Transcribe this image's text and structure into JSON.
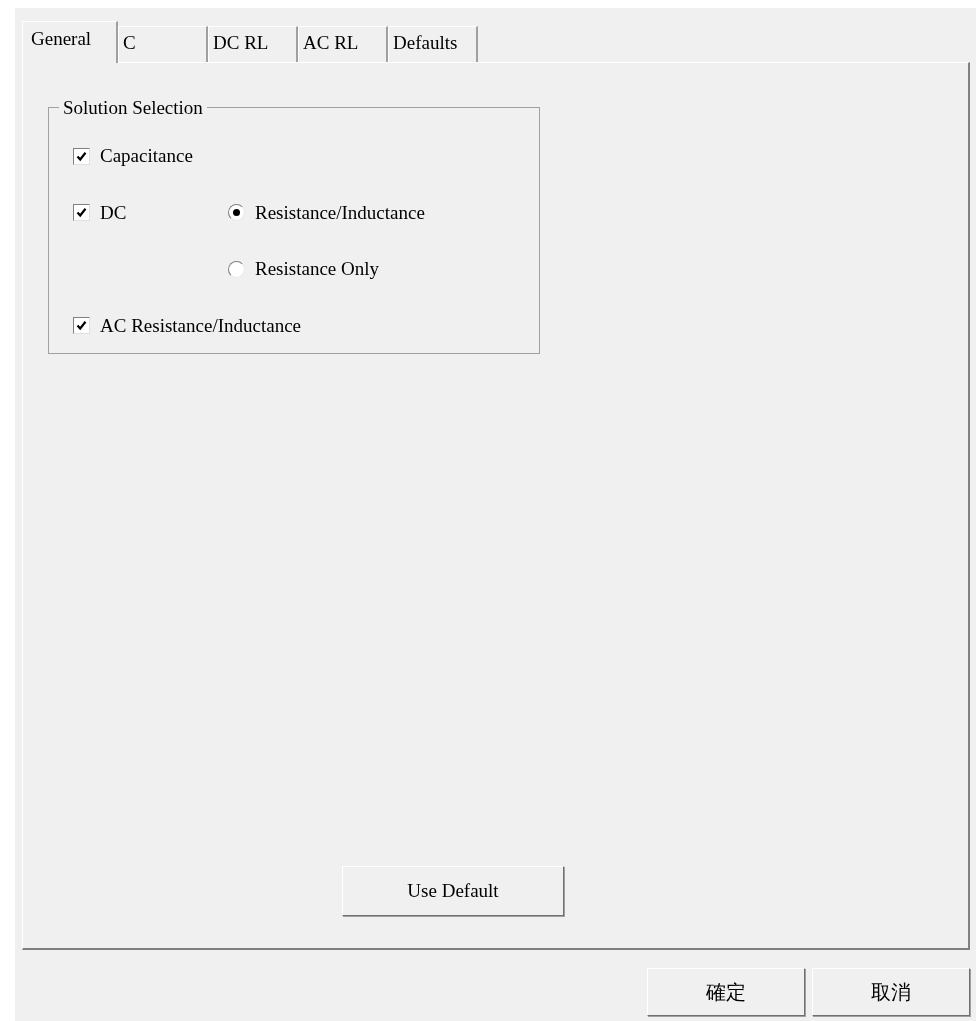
{
  "tabs": [
    {
      "label": "General",
      "selected": true
    },
    {
      "label": "C",
      "selected": false
    },
    {
      "label": "DC RL",
      "selected": false
    },
    {
      "label": "AC RL",
      "selected": false
    },
    {
      "label": "Defaults",
      "selected": false
    }
  ],
  "group": {
    "title": "Solution Selection",
    "options": [
      {
        "kind": "checkbox",
        "label": "Capacitance",
        "checked": true
      },
      {
        "kind": "checkbox",
        "label": "DC",
        "checked": true,
        "radios": [
          {
            "label": "Resistance/Inductance",
            "selected": true
          },
          {
            "label": "Resistance Only",
            "selected": false
          }
        ]
      },
      {
        "kind": "checkbox",
        "label": "AC Resistance/Inductance",
        "checked": true
      }
    ]
  },
  "use_default_button": "Use Default",
  "buttons": [
    "確定",
    "取消"
  ]
}
